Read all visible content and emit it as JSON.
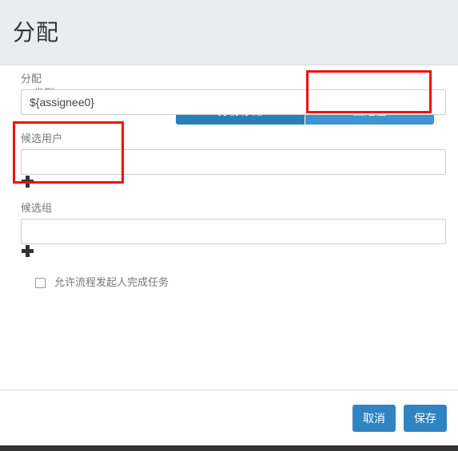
{
  "dialog": {
    "title": "分配"
  },
  "type_row": {
    "label": "类型",
    "options": [
      {
        "label": "身份存储",
        "selected": false
      },
      {
        "label": "固定值",
        "selected": true
      }
    ]
  },
  "fields": {
    "assignee": {
      "label": "分配",
      "value": "${assignee0}",
      "placeholder": ""
    },
    "candidate_users": {
      "label": "候选用户",
      "value": "",
      "placeholder": "",
      "add_icon": "plus-icon"
    },
    "candidate_groups": {
      "label": "候选组",
      "value": "",
      "placeholder": "",
      "add_icon": "plus-icon"
    }
  },
  "checkbox": {
    "label": "允许流程发起人完成任务",
    "checked": false
  },
  "footer": {
    "cancel_label": "取消",
    "save_label": "保存"
  },
  "colors": {
    "header_background": "#e8edf1",
    "button_unselected": "#2a7fb8",
    "button_selected": "#3d94ce",
    "footer_button": "#3084c2",
    "annotation": "#ee1111",
    "label_text": "#777777",
    "title_text": "#333333"
  }
}
